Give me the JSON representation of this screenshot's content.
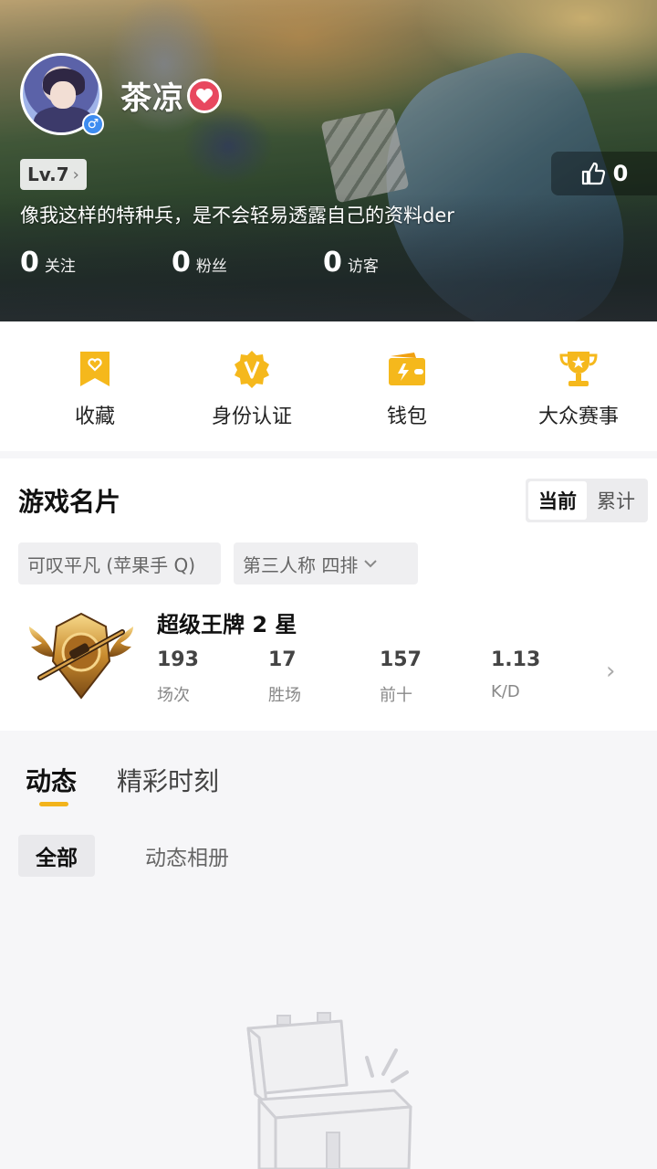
{
  "profile": {
    "username": "茶凉",
    "level": "Lv.7",
    "bio": "像我这样的特种兵，是不会轻易透露自己的资料der",
    "likes": "0",
    "gender_icon": "male-icon",
    "stats": [
      {
        "value": "0",
        "label": "关注"
      },
      {
        "value": "0",
        "label": "粉丝"
      },
      {
        "value": "0",
        "label": "访客"
      }
    ]
  },
  "quick_actions": [
    {
      "label": "收藏",
      "icon": "bookmark-heart-icon"
    },
    {
      "label": "身份认证",
      "icon": "v-badge-icon"
    },
    {
      "label": "钱包",
      "icon": "wallet-icon"
    },
    {
      "label": "大众赛事",
      "icon": "trophy-icon"
    }
  ],
  "game_card": {
    "title": "游戏名片",
    "toggle": {
      "current": "当前",
      "cumulative": "累计"
    },
    "account": "可叹平凡 (苹果手 Q)",
    "mode": "第三人称  四排",
    "rank": "超级王牌 2 星",
    "stats": [
      {
        "value": "193",
        "label": "场次"
      },
      {
        "value": "17",
        "label": "胜场"
      },
      {
        "value": "157",
        "label": "前十"
      },
      {
        "value": "1.13",
        "label": "K/D"
      }
    ]
  },
  "feed": {
    "tabs": [
      "动态",
      "精彩时刻"
    ],
    "filters": [
      "全部",
      "动态相册"
    ]
  },
  "colors": {
    "accent": "#f2b31b",
    "heart": "#e8485f",
    "male": "#3d8cf0"
  }
}
